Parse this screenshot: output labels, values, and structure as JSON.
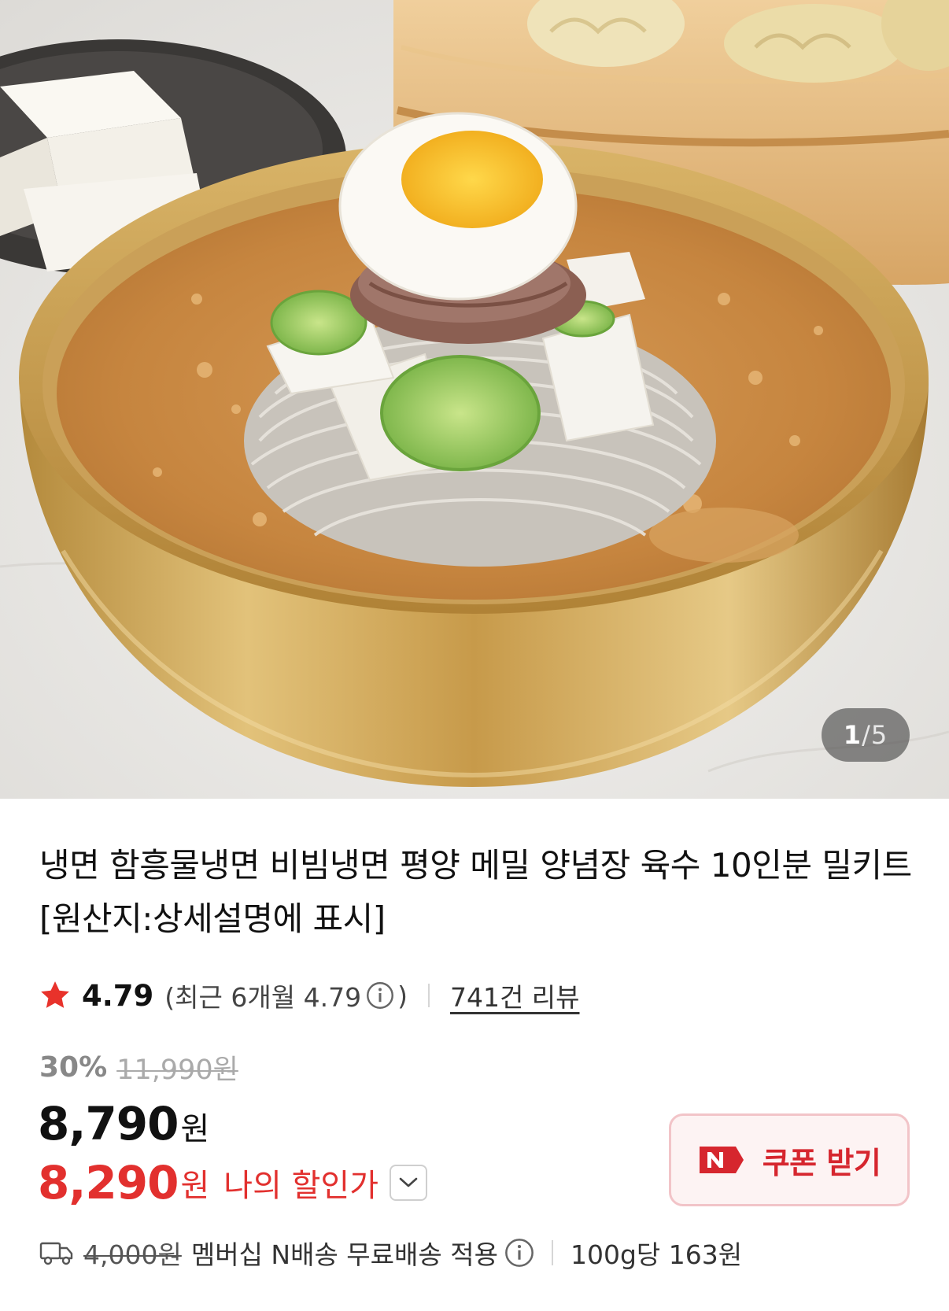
{
  "gallery": {
    "current": "1",
    "separator": "/",
    "total": "5",
    "image_alt": "냉면 함흥물냉면 비빔냉면 평양 메밀 양념장 육수 10인분 밀키트 [원산지:상세설명에 표시]"
  },
  "product": {
    "title": "냉면 함흥물냉면 비빔냉면 평양 메밀 양념장 육수 10인분 밀키트 [원산지:상세설명에 표시]"
  },
  "rating": {
    "score": "4.79",
    "recent_text": "(최근 6개월 4.79",
    "recent_close": ")",
    "reviews_link": "741건 리뷰",
    "icon": "star-icon"
  },
  "price": {
    "discount_rate": "30%",
    "original": "11,990원",
    "sale_number": "8,790",
    "sale_unit": "원",
    "my_number": "8,290",
    "my_unit": "원",
    "my_label": "나의 할인가"
  },
  "coupon": {
    "label": "쿠폰 받기",
    "icon": "naver-n-icon"
  },
  "shipping": {
    "fee_struck": "4,000원",
    "text": "멤버십 N배송 무료배송 적용",
    "unit_price": "100g당 163원",
    "icon": "truck-icon"
  },
  "colors": {
    "accent_red": "#e2302e",
    "coupon_bg": "#fdf3f3",
    "coupon_border": "#f2c4c8"
  }
}
